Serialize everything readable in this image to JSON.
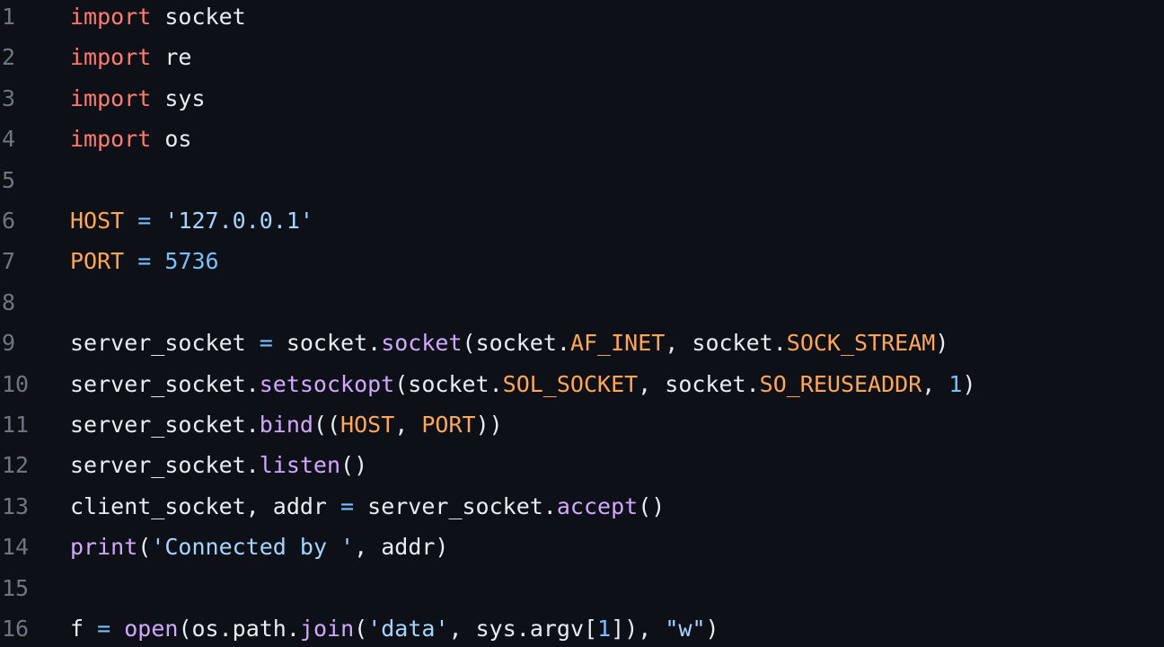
{
  "theme": {
    "background": "#0d1117",
    "line_number": "#6e7681",
    "default_text": "#e6edf3",
    "keyword": "#ff7b72",
    "constant": "#ffa657",
    "operator": "#79c0ff",
    "number": "#79c0ff",
    "string": "#a5d6ff",
    "function": "#d2a8ff"
  },
  "lines": [
    {
      "n": "1",
      "tokens": [
        {
          "t": "kw",
          "v": "import"
        },
        {
          "t": "id",
          "v": " socket"
        }
      ]
    },
    {
      "n": "2",
      "tokens": [
        {
          "t": "kw",
          "v": "import"
        },
        {
          "t": "id",
          "v": " re"
        }
      ]
    },
    {
      "n": "3",
      "tokens": [
        {
          "t": "kw",
          "v": "import"
        },
        {
          "t": "id",
          "v": " sys"
        }
      ]
    },
    {
      "n": "4",
      "tokens": [
        {
          "t": "kw",
          "v": "import"
        },
        {
          "t": "id",
          "v": " os"
        }
      ]
    },
    {
      "n": "5",
      "tokens": []
    },
    {
      "n": "6",
      "tokens": [
        {
          "t": "cn",
          "v": "HOST"
        },
        {
          "t": "id",
          "v": " "
        },
        {
          "t": "op",
          "v": "="
        },
        {
          "t": "id",
          "v": " "
        },
        {
          "t": "str",
          "v": "'127.0.0.1'"
        }
      ]
    },
    {
      "n": "7",
      "tokens": [
        {
          "t": "cn",
          "v": "PORT"
        },
        {
          "t": "id",
          "v": " "
        },
        {
          "t": "op",
          "v": "="
        },
        {
          "t": "id",
          "v": " "
        },
        {
          "t": "num",
          "v": "5736"
        }
      ]
    },
    {
      "n": "8",
      "tokens": []
    },
    {
      "n": "9",
      "tokens": [
        {
          "t": "id",
          "v": "server_socket "
        },
        {
          "t": "op",
          "v": "="
        },
        {
          "t": "id",
          "v": " socket."
        },
        {
          "t": "fn",
          "v": "socket"
        },
        {
          "t": "id",
          "v": "(socket."
        },
        {
          "t": "cn",
          "v": "AF_INET"
        },
        {
          "t": "id",
          "v": ", socket."
        },
        {
          "t": "cn",
          "v": "SOCK_STREAM"
        },
        {
          "t": "id",
          "v": ")"
        }
      ]
    },
    {
      "n": "10",
      "tokens": [
        {
          "t": "id",
          "v": "server_socket."
        },
        {
          "t": "fn",
          "v": "setsockopt"
        },
        {
          "t": "id",
          "v": "(socket."
        },
        {
          "t": "cn",
          "v": "SOL_SOCKET"
        },
        {
          "t": "id",
          "v": ", socket."
        },
        {
          "t": "cn",
          "v": "SO_REUSEADDR"
        },
        {
          "t": "id",
          "v": ", "
        },
        {
          "t": "num",
          "v": "1"
        },
        {
          "t": "id",
          "v": ")"
        }
      ]
    },
    {
      "n": "11",
      "tokens": [
        {
          "t": "id",
          "v": "server_socket."
        },
        {
          "t": "fn",
          "v": "bind"
        },
        {
          "t": "id",
          "v": "(("
        },
        {
          "t": "cn",
          "v": "HOST"
        },
        {
          "t": "id",
          "v": ", "
        },
        {
          "t": "cn",
          "v": "PORT"
        },
        {
          "t": "id",
          "v": "))"
        }
      ]
    },
    {
      "n": "12",
      "tokens": [
        {
          "t": "id",
          "v": "server_socket."
        },
        {
          "t": "fn",
          "v": "listen"
        },
        {
          "t": "id",
          "v": "()"
        }
      ]
    },
    {
      "n": "13",
      "tokens": [
        {
          "t": "id",
          "v": "client_socket, addr "
        },
        {
          "t": "op",
          "v": "="
        },
        {
          "t": "id",
          "v": " server_socket."
        },
        {
          "t": "fn",
          "v": "accept"
        },
        {
          "t": "id",
          "v": "()"
        }
      ]
    },
    {
      "n": "14",
      "tokens": [
        {
          "t": "fn",
          "v": "print"
        },
        {
          "t": "id",
          "v": "("
        },
        {
          "t": "str",
          "v": "'Connected by '"
        },
        {
          "t": "id",
          "v": ", addr)"
        }
      ]
    },
    {
      "n": "15",
      "tokens": []
    },
    {
      "n": "16",
      "tokens": [
        {
          "t": "id",
          "v": "f "
        },
        {
          "t": "op",
          "v": "="
        },
        {
          "t": "id",
          "v": " "
        },
        {
          "t": "fn",
          "v": "open"
        },
        {
          "t": "id",
          "v": "(os.path."
        },
        {
          "t": "fn",
          "v": "join"
        },
        {
          "t": "id",
          "v": "("
        },
        {
          "t": "str",
          "v": "'data'"
        },
        {
          "t": "id",
          "v": ", sys.argv["
        },
        {
          "t": "num",
          "v": "1"
        },
        {
          "t": "id",
          "v": "]), "
        },
        {
          "t": "str",
          "v": "\"w\""
        },
        {
          "t": "id",
          "v": ")"
        }
      ]
    }
  ]
}
